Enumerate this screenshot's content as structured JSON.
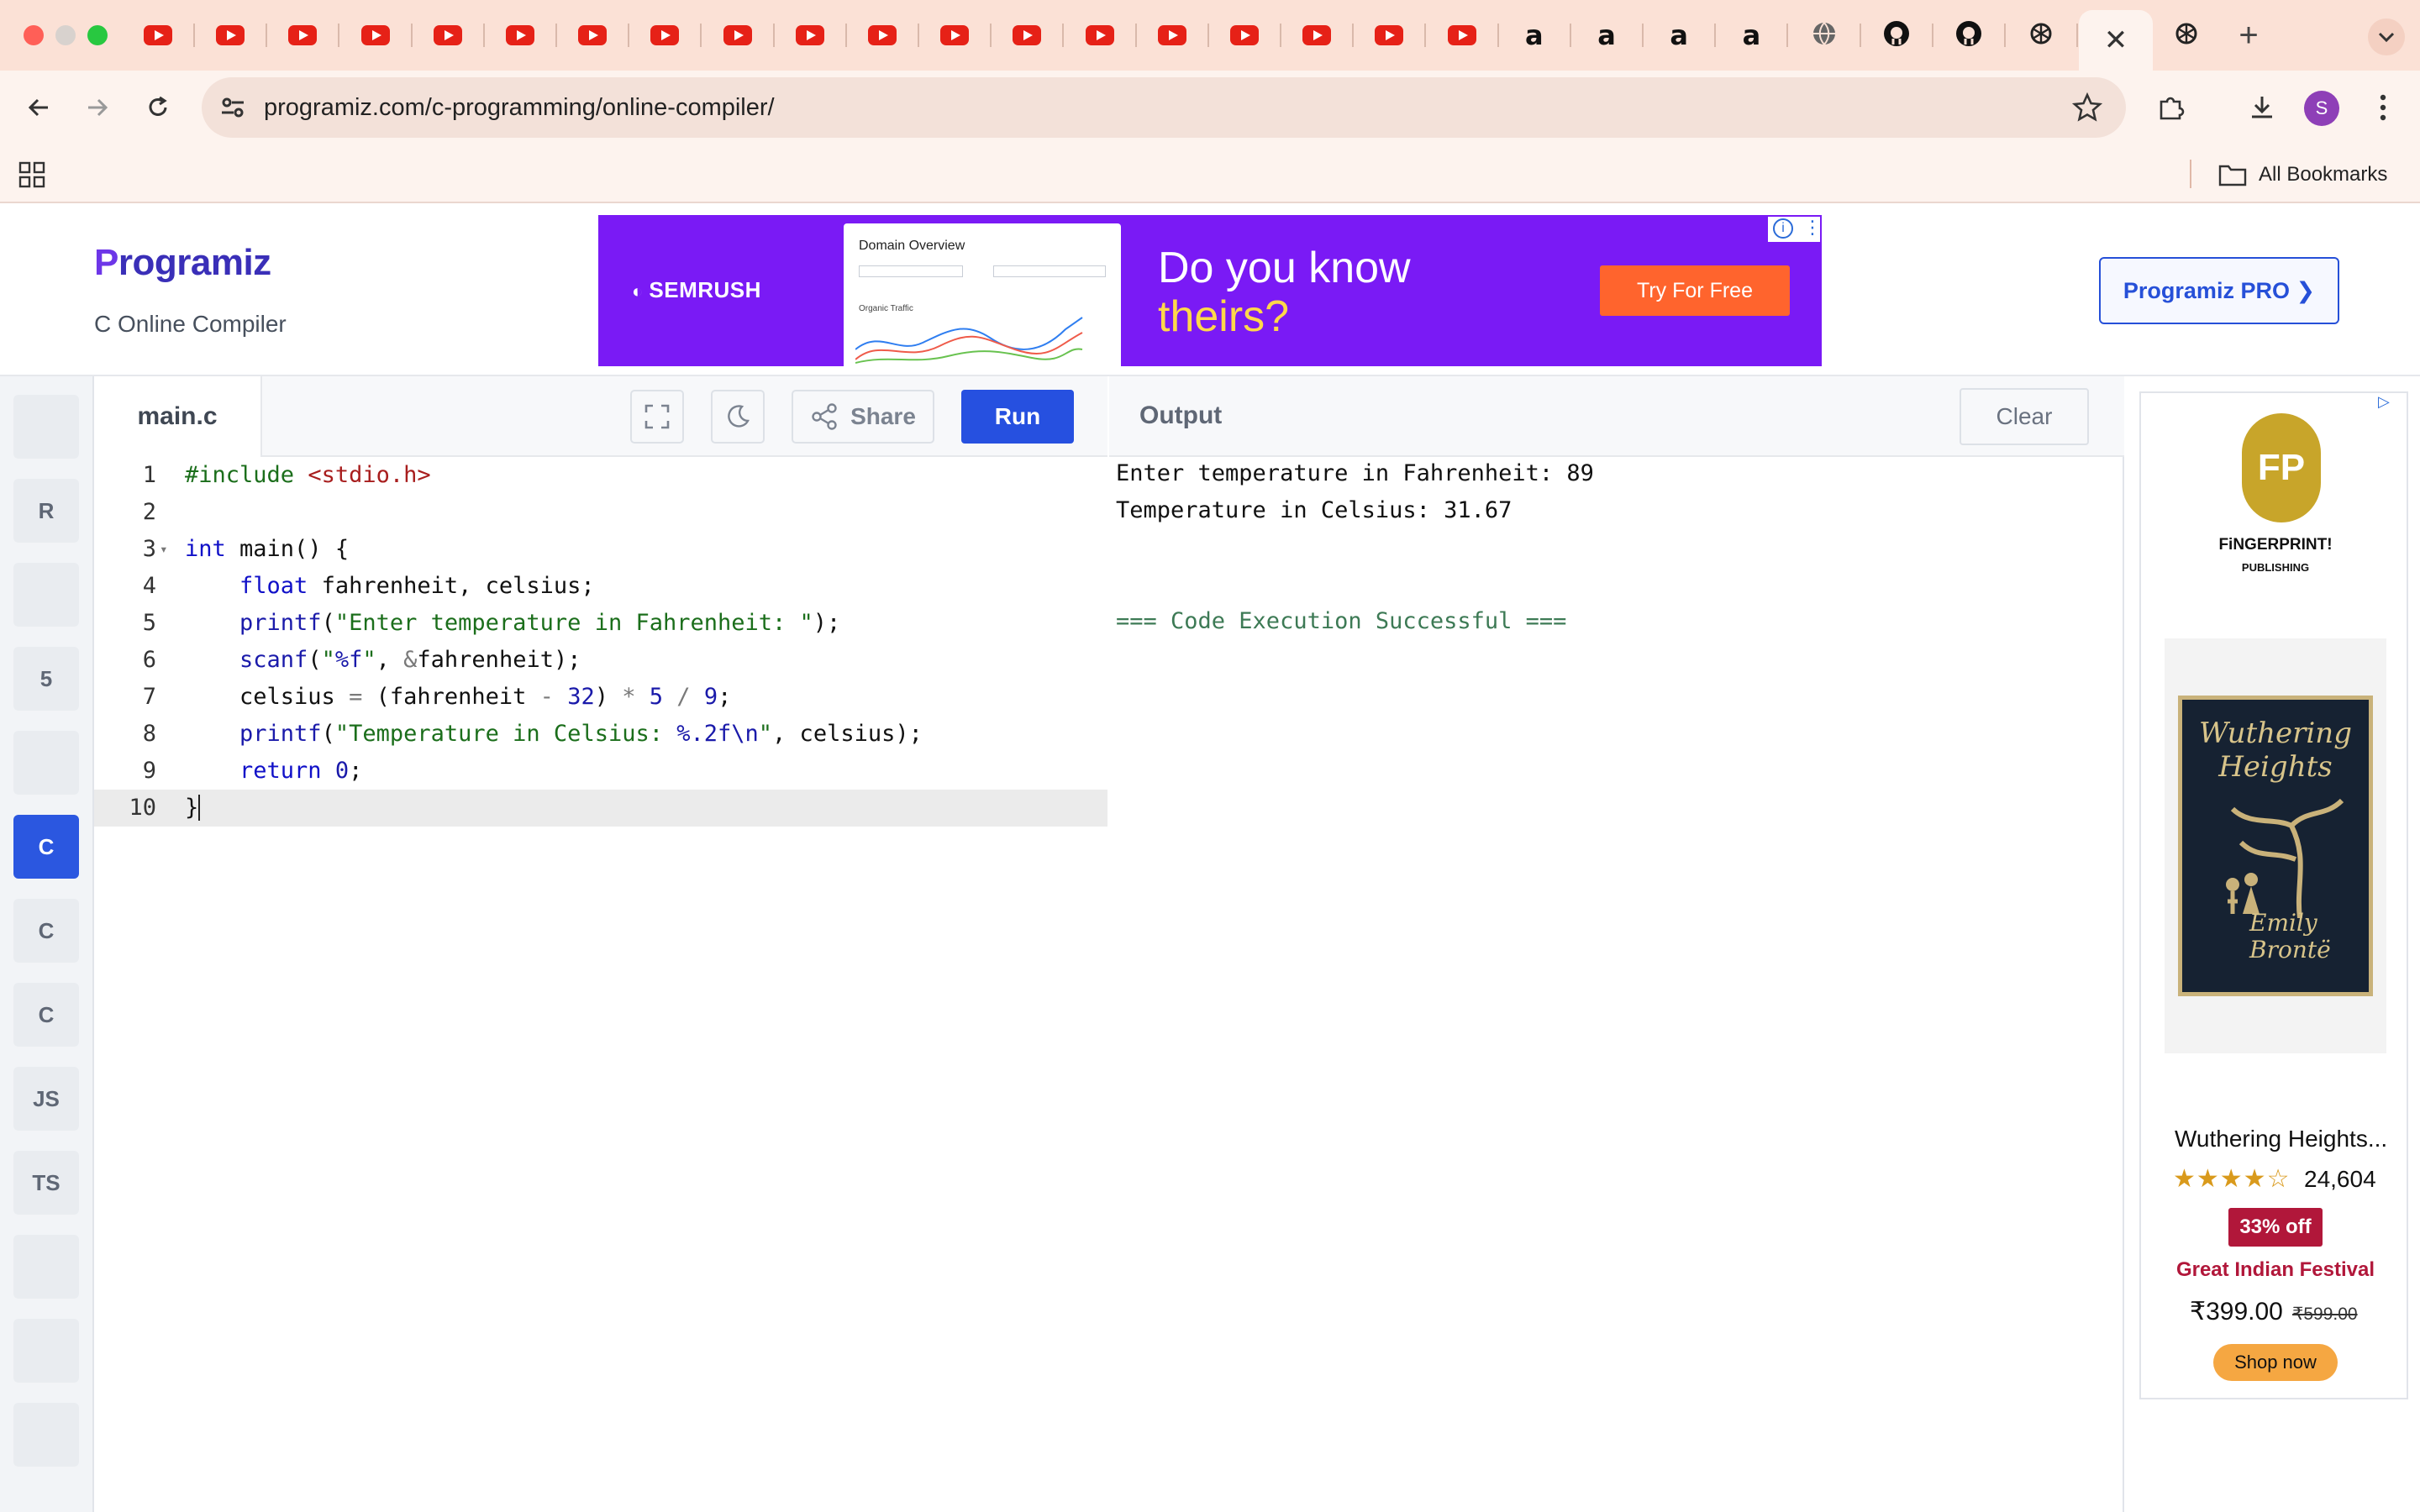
{
  "browser": {
    "url": "programiz.com/c-programming/online-compiler/",
    "bookmarks_label": "All Bookmarks",
    "profile_initial": "S",
    "active_tab_close": "✕",
    "new_tab": "+",
    "tab_favicons": [
      "youtube",
      "youtube",
      "youtube",
      "youtube",
      "youtube",
      "youtube",
      "youtube",
      "youtube",
      "youtube",
      "youtube",
      "youtube",
      "youtube",
      "youtube",
      "youtube",
      "youtube",
      "youtube",
      "youtube",
      "youtube",
      "youtube",
      "amazon",
      "amazon",
      "amazon",
      "amazon",
      "globe",
      "github",
      "github",
      "openai",
      "close",
      "openai"
    ],
    "amazon_glyph": "a"
  },
  "header": {
    "logo_first": "P",
    "logo_rest": "rogramiz",
    "subtitle": "C Online Compiler",
    "pro_button": "Programiz PRO ❯"
  },
  "banner_ad": {
    "brand": "SEMRUSH",
    "card_title": "Domain Overview",
    "card_subtitle": "Organic Traffic",
    "headline_1": "Do you know",
    "headline_2": "theirs?",
    "cta": "Try For Free"
  },
  "languages": [
    {
      "name": "python-icon",
      "label": "",
      "active": false
    },
    {
      "name": "r-icon",
      "label": "R",
      "active": false
    },
    {
      "name": "sql-icon",
      "label": "",
      "active": false
    },
    {
      "name": "html-icon",
      "label": "5",
      "active": false
    },
    {
      "name": "java-icon",
      "label": "",
      "active": false
    },
    {
      "name": "c-icon",
      "label": "C",
      "active": true
    },
    {
      "name": "cpp-icon",
      "label": "C",
      "active": false
    },
    {
      "name": "csharp-icon",
      "label": "C",
      "active": false
    },
    {
      "name": "js-icon",
      "label": "JS",
      "active": false
    },
    {
      "name": "ts-icon",
      "label": "TS",
      "active": false
    },
    {
      "name": "go-icon",
      "label": "",
      "active": false
    },
    {
      "name": "php-icon",
      "label": "",
      "active": false
    },
    {
      "name": "swift-icon",
      "label": "",
      "active": false
    }
  ],
  "editor": {
    "file_name": "main.c",
    "share_label": "Share",
    "run_label": "Run",
    "lines": [
      "#include <stdio.h>",
      "",
      "int main() {",
      "    float fahrenheit, celsius;",
      "    printf(\"Enter temperature in Fahrenheit: \");",
      "    scanf(\"%f\", &fahrenheit);",
      "    celsius = (fahrenheit - 32) * 5 / 9;",
      "    printf(\"Temperature in Celsius: %.2f\\n\", celsius);",
      "    return 0;",
      "}"
    ],
    "line_numbers": [
      "1",
      "2",
      "3",
      "4",
      "5",
      "6",
      "7",
      "8",
      "9",
      "10"
    ]
  },
  "output": {
    "title": "Output",
    "clear_label": "Clear",
    "line_1": "Enter temperature in Fahrenheit: 89",
    "line_2": "Temperature in Celsius: 31.67",
    "status": "=== Code Execution Successful ==="
  },
  "side_ad": {
    "publisher_logo": "FP",
    "publisher": "FiNGERPRINT!",
    "publisher_sub": "PUBLISHING",
    "book_title": "Wuthering Heights",
    "book_author": "Emily Brontë",
    "product": "Wuthering Heights...",
    "stars": "★★★★☆",
    "rating_count": "24,604",
    "discount": "33% off",
    "event": "Great Indian Festival",
    "price": "₹399.00",
    "mrp": "₹599.00",
    "cta": "Shop now"
  }
}
